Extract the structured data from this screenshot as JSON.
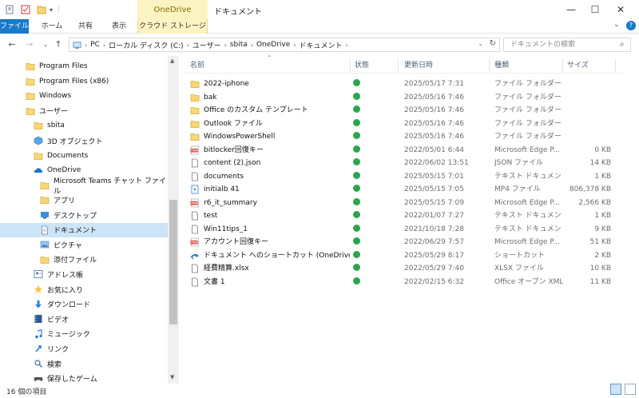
{
  "title": "ドキュメント",
  "context_tab_group": "OneDrive",
  "ribbon_tabs": [
    "ファイル",
    "ホーム",
    "共有",
    "表示",
    "クラウド ストレージ"
  ],
  "breadcrumb": [
    "PC",
    "ローカル ディスク (C:)",
    "ユーザー",
    "sbita",
    "OneDrive",
    "ドキュメント"
  ],
  "search_placeholder": "ドキュメントの検索",
  "nav": [
    {
      "label": "Program Files",
      "icon": "folder-icon",
      "indent": 1
    },
    {
      "label": "Program Files (x86)",
      "icon": "folder-icon",
      "indent": 1
    },
    {
      "label": "Windows",
      "icon": "folder-icon",
      "indent": 1
    },
    {
      "label": "ユーザー",
      "icon": "folder-icon",
      "indent": 1
    },
    {
      "label": "sbita",
      "icon": "folder-icon",
      "indent": 2
    },
    {
      "label": "3D オブジェクト",
      "icon": "cube-icon",
      "indent": 2
    },
    {
      "label": "Documents",
      "icon": "folder-icon",
      "indent": 2
    },
    {
      "label": "OneDrive",
      "icon": "cloud-icon",
      "indent": 2
    },
    {
      "label": "Microsoft Teams チャット ファイル",
      "icon": "folder-icon",
      "indent": 3
    },
    {
      "label": "アプリ",
      "icon": "folder-icon",
      "indent": 3
    },
    {
      "label": "デスクトップ",
      "icon": "desktop-icon",
      "indent": 3
    },
    {
      "label": "ドキュメント",
      "icon": "document-icon",
      "indent": 3,
      "selected": true
    },
    {
      "label": "ピクチャ",
      "icon": "picture-icon",
      "indent": 3
    },
    {
      "label": "添付ファイル",
      "icon": "folder-icon",
      "indent": 3
    },
    {
      "label": "アドレス帳",
      "icon": "contacts-icon",
      "indent": 2
    },
    {
      "label": "お気に入り",
      "icon": "star-icon",
      "indent": 2
    },
    {
      "label": "ダウンロード",
      "icon": "download-icon",
      "indent": 2
    },
    {
      "label": "ビデオ",
      "icon": "video-icon",
      "indent": 2
    },
    {
      "label": "ミュージック",
      "icon": "music-icon",
      "indent": 2
    },
    {
      "label": "リンク",
      "icon": "link-icon",
      "indent": 2
    },
    {
      "label": "検索",
      "icon": "search-icon",
      "indent": 2
    },
    {
      "label": "保存したゲーム",
      "icon": "game-icon",
      "indent": 2
    }
  ],
  "columns": {
    "name": "名前",
    "status": "状態",
    "date": "更新日時",
    "type": "種類",
    "size": "サイズ"
  },
  "files": [
    {
      "name": "2022-iphone",
      "date": "2025/05/17 7:31",
      "type": "ファイル フォルダー",
      "size": "",
      "icon": "folder-icon"
    },
    {
      "name": "bak",
      "date": "2025/05/16 7:46",
      "type": "ファイル フォルダー",
      "size": "",
      "icon": "folder-icon"
    },
    {
      "name": "Office のカスタム テンプレート",
      "date": "2025/05/16 7:46",
      "type": "ファイル フォルダー",
      "size": "",
      "icon": "folder-icon"
    },
    {
      "name": "Outlook ファイル",
      "date": "2025/05/16 7:46",
      "type": "ファイル フォルダー",
      "size": "",
      "icon": "folder-icon"
    },
    {
      "name": "WindowsPowerShell",
      "date": "2025/05/16 7:46",
      "type": "ファイル フォルダー",
      "size": "",
      "icon": "folder-icon"
    },
    {
      "name": "bitlocker回復キー",
      "date": "2022/05/01 6:44",
      "type": "Microsoft Edge P...",
      "size": "0 KB",
      "icon": "pdf-icon"
    },
    {
      "name": "content (2).json",
      "date": "2022/06/02 13:51",
      "type": "JSON ファイル",
      "size": "14 KB",
      "icon": "file-icon"
    },
    {
      "name": "documents",
      "date": "2025/05/15 7:01",
      "type": "テキスト ドキュメント",
      "size": "1 KB",
      "icon": "file-icon"
    },
    {
      "name": "initialb 41",
      "date": "2025/05/15 7:05",
      "type": "MP4 ファイル",
      "size": "806,378 KB",
      "icon": "video-file-icon"
    },
    {
      "name": "r6_it_summary",
      "date": "2025/05/15 7:09",
      "type": "Microsoft Edge P...",
      "size": "2,566 KB",
      "icon": "pdf-icon"
    },
    {
      "name": "test",
      "date": "2022/01/07 7:27",
      "type": "テキスト ドキュメント",
      "size": "1 KB",
      "icon": "file-icon"
    },
    {
      "name": "Win11tips_1",
      "date": "2021/10/18 7:28",
      "type": "テキスト ドキュメント",
      "size": "9 KB",
      "icon": "file-icon"
    },
    {
      "name": "アカウント回復キー",
      "date": "2022/06/29 7:57",
      "type": "Microsoft Edge P...",
      "size": "51 KB",
      "icon": "pdf-icon"
    },
    {
      "name": "ドキュメント へのショートカット (OneDrive - 個...",
      "date": "2025/05/29 8:17",
      "type": "ショートカット",
      "size": "2 KB",
      "icon": "shortcut-icon"
    },
    {
      "name": "経費精算.xlsx",
      "date": "2022/05/29 7:40",
      "type": "XLSX ファイル",
      "size": "10 KB",
      "icon": "file-icon"
    },
    {
      "name": "文書 1",
      "date": "2022/02/15 6:32",
      "type": "Office オープン XML...",
      "size": "11 KB",
      "icon": "file-icon"
    }
  ],
  "status_text": "16 個の項目",
  "colors": {
    "accent": "#1979ca",
    "selected": "#cce4f7",
    "folder": "#f8d775",
    "sync_ok": "#2da44e",
    "context_tab": "#fbf3c2"
  }
}
